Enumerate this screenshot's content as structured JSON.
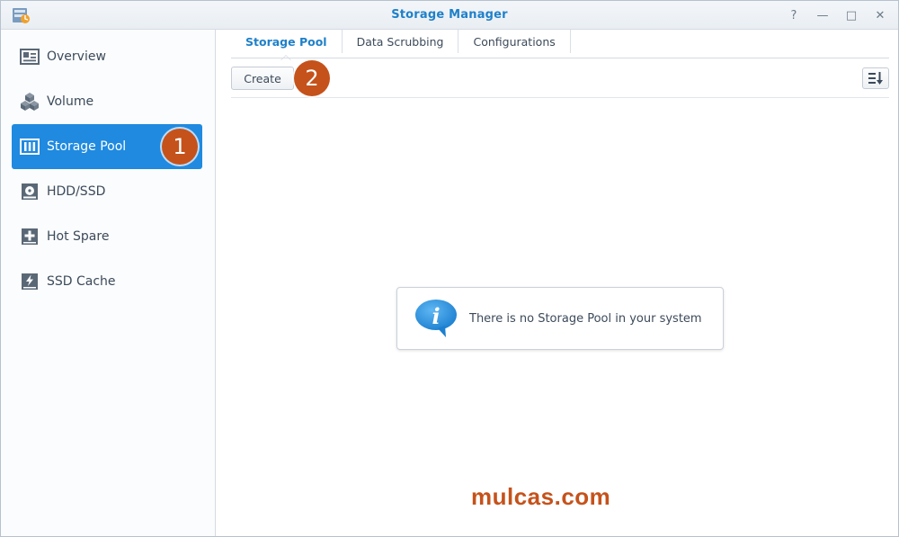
{
  "window": {
    "title": "Storage Manager",
    "buttons": [
      "?",
      "—",
      "□",
      "✕"
    ]
  },
  "sidebar": {
    "items": [
      {
        "label": "Overview",
        "icon": "overview-icon"
      },
      {
        "label": "Volume",
        "icon": "volume-icon"
      },
      {
        "label": "Storage Pool",
        "icon": "storage-pool-icon",
        "active": true
      },
      {
        "label": "HDD/SSD",
        "icon": "hdd-icon"
      },
      {
        "label": "Hot Spare",
        "icon": "hot-spare-icon"
      },
      {
        "label": "SSD Cache",
        "icon": "ssd-cache-icon"
      }
    ]
  },
  "tabs": [
    {
      "label": "Storage Pool",
      "active": true
    },
    {
      "label": "Data Scrubbing"
    },
    {
      "label": "Configurations"
    }
  ],
  "toolbar": {
    "create_label": "Create"
  },
  "empty_state": {
    "message": "There is no Storage Pool in your system"
  },
  "annotations": {
    "step1": "1",
    "step2": "2"
  },
  "watermark": "mulcas.com",
  "colors": {
    "accent": "#1f8ae0",
    "title": "#1f80c9",
    "badge": "#c5521b"
  }
}
